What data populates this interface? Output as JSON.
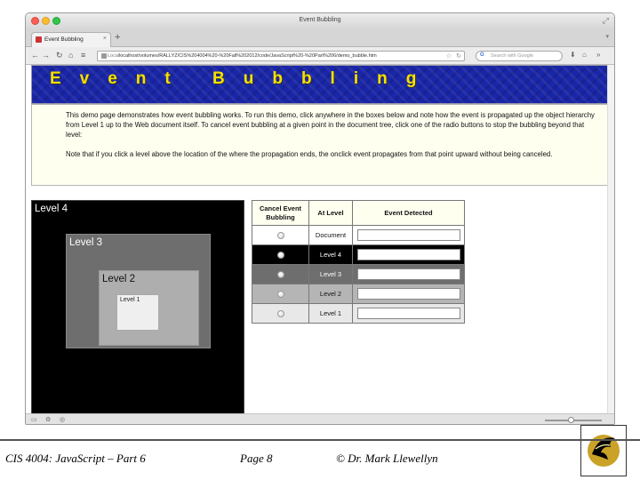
{
  "window": {
    "title": "Event Bubbling",
    "tab_label": "Event Bubbling",
    "new_tab": "+",
    "tab_close": "×",
    "url_local_label": "Local",
    "url": "localhost/volumes/RALLYZ/CIS%204004%20-%20Fall%202012/code/JavaScript%20-%20Part%206/demo_bubble.htm",
    "search_placeholder": "Search with Google"
  },
  "nav": {
    "back": "←",
    "forward": "→",
    "icons": [
      "↻",
      "⌂",
      "≡"
    ]
  },
  "banner": {
    "title": "Event Bubbling"
  },
  "description": {
    "para1": "This demo page demonstrates how event bubbling works. To run this demo, click anywhere in the boxes below and note how the event is propagated up the object hierarchy from Level 1 up to the Web document itself. To cancel event bubbling at a given point in the document tree, click one of the radio buttons to stop the bubbling beyond that level:",
    "para2": "Note that if you click a level above the location of the where the propagation ends, the onclick event propagates from that point upward without being canceled."
  },
  "levels": {
    "level4": "Level 4",
    "level3": "Level 3",
    "level2": "Level 2",
    "level1": "Level 1"
  },
  "table": {
    "headers": [
      "Cancel Event Bubbling",
      "At Level",
      "Event Detected"
    ],
    "rows": [
      {
        "level": "Document",
        "detected": ""
      },
      {
        "level": "Level 4",
        "detected": ""
      },
      {
        "level": "Level 3",
        "detected": ""
      },
      {
        "level": "Level 2",
        "detected": ""
      },
      {
        "level": "Level 1",
        "detected": ""
      }
    ]
  },
  "footer": {
    "course": "CIS 4004: JavaScript – Part 6",
    "page": "Page 8",
    "author": "© Dr. Mark Llewellyn"
  },
  "colors": {
    "banner_bg": "#1a26a8",
    "banner_text": "#f5e100",
    "level4": "#000000",
    "level3": "#6e6e6e",
    "level2": "#aeaeae",
    "level1": "#efefef"
  }
}
